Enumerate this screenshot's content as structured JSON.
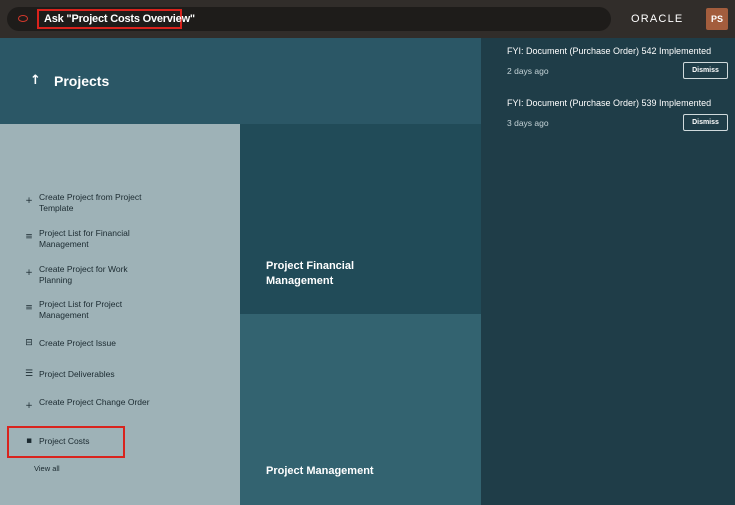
{
  "topbar": {
    "search_prompt": "Ask \"Project Costs Overview\"",
    "search_icon": "oracle-oval-icon",
    "brand": "ORACLE",
    "avatar_initials": "PS"
  },
  "header": {
    "back_icon": "up-arrow-icon",
    "title": "Projects"
  },
  "quick_actions": [
    {
      "icon": "plus-icon",
      "glyph": "+",
      "label": "Create Project from Project Template"
    },
    {
      "icon": "list-icon",
      "glyph": "≡",
      "label": "Project List for Financial Management"
    },
    {
      "icon": "plus-icon",
      "glyph": "+",
      "label": "Create Project for Work Planning"
    },
    {
      "icon": "list-icon",
      "glyph": "≡",
      "label": "Project List for Project Management"
    },
    {
      "icon": "issue-icon",
      "glyph": "⊟",
      "label": "Create Project Issue"
    },
    {
      "icon": "checklist-icon",
      "glyph": "☰",
      "label": "Project Deliverables"
    },
    {
      "icon": "plus-icon",
      "glyph": "+",
      "label": "Create Project Change Order"
    },
    {
      "icon": "costs-icon",
      "glyph": "▪",
      "label": "Project Costs"
    }
  ],
  "view_all": "View all",
  "tiles": {
    "financial": "Project Financial Management",
    "management": "Project Management"
  },
  "notifications": [
    {
      "title": "FYI: Document (Purchase Order) 542 Implemented",
      "time": "2 days ago",
      "action": "Dismiss"
    },
    {
      "title": "FYI: Document (Purchase Order) 539 Implemented",
      "time": "3 days ago",
      "action": "Dismiss"
    }
  ],
  "colors": {
    "accent_red": "#d9231d",
    "header_teal": "#2b5766",
    "panel_grey": "#9eb2b7",
    "tile_dark": "#214b58",
    "tile_mid": "#336370"
  }
}
